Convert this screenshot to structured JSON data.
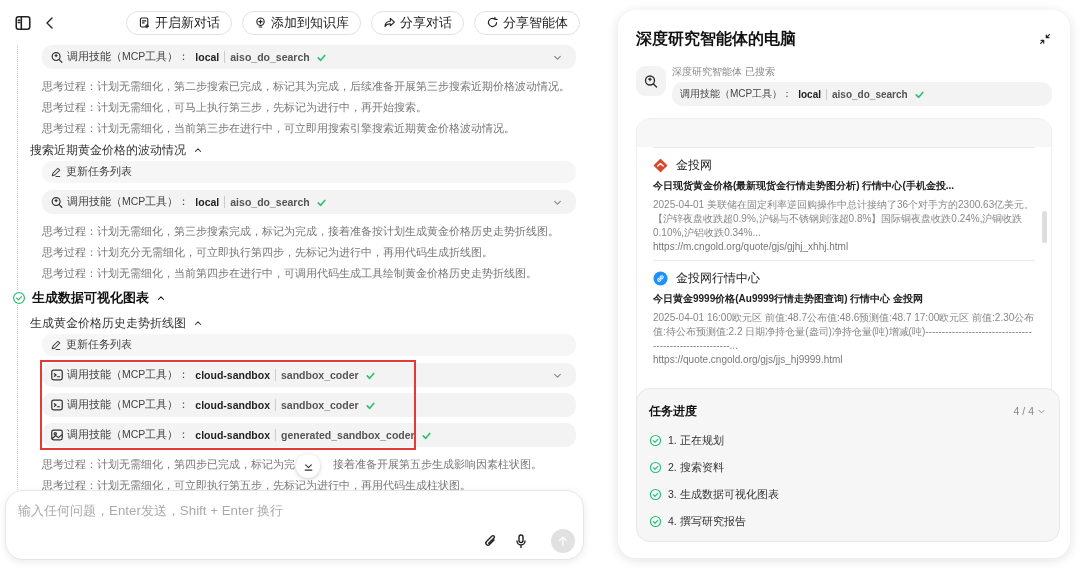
{
  "header": {
    "buttons": [
      {
        "label": "开启新对话"
      },
      {
        "label": "添加到知识库"
      },
      {
        "label": "分享对话"
      },
      {
        "label": "分享智能体"
      }
    ]
  },
  "log": [
    {
      "kind": "search-tool",
      "label": "调用技能（MCP工具）：",
      "server": "local",
      "tool": "aiso_do_search",
      "done": true,
      "expandable": true
    },
    {
      "kind": "thought",
      "text": "思考过程：计划无需细化，第二步搜索已完成，标记其为完成，后续准备开展第三步搜索近期价格波动情况。"
    },
    {
      "kind": "thought",
      "text": "思考过程：计划无需细化，可马上执行第三步，先标记为进行中，再开始搜索。"
    },
    {
      "kind": "thought",
      "text": "思考过程：计划无需细化，当前第三步在进行中，可立即用搜索引擎搜索近期黄金价格波动情况。"
    },
    {
      "kind": "section",
      "text": "搜索近期黄金价格的波动情况",
      "expanded": true
    },
    {
      "kind": "update",
      "text": "更新任务列表"
    },
    {
      "kind": "search-tool",
      "label": "调用技能（MCP工具）：",
      "server": "local",
      "tool": "aiso_do_search",
      "done": true,
      "expandable": true
    },
    {
      "kind": "thought",
      "text": "思考过程：计划无需细化，第三步搜索完成，标记为完成，接着准备按计划生成黄金价格历史走势折线图。"
    },
    {
      "kind": "thought",
      "text": "思考过程：计划充分无需细化，可立即执行第四步，先标记为进行中，再用代码生成折线图。"
    },
    {
      "kind": "thought",
      "text": "思考过程：计划无需细化，当前第四步在进行中，可调用代码生成工具绘制黄金价格历史走势折线图。"
    },
    {
      "kind": "step",
      "text": "生成数据可视化图表",
      "done": true,
      "expanded": true
    },
    {
      "kind": "section",
      "text": "生成黄金价格历史走势折线图",
      "expanded": true
    },
    {
      "kind": "update",
      "text": "更新任务列表"
    },
    {
      "kind": "group",
      "highlighted": true,
      "items": [
        {
          "kind": "code-tool",
          "label": "调用技能（MCP工具）：",
          "server": "cloud-sandbox",
          "tool": "sandbox_coder",
          "done": true,
          "expandable": true
        },
        {
          "kind": "code-tool",
          "label": "调用技能（MCP工具）：",
          "server": "cloud-sandbox",
          "tool": "sandbox_coder",
          "done": true,
          "expandable": false
        },
        {
          "kind": "image-tool",
          "label": "调用技能（MCP工具）：",
          "server": "cloud-sandbox",
          "tool": "generated_sandbox_coder",
          "done": true,
          "expandable": false
        }
      ]
    },
    {
      "kind": "thought",
      "parts": [
        "思考过程：计划无需细化，第四步已完成，标记为完",
        "接着准备开展第五步生成影响因素柱状图。"
      ]
    },
    {
      "kind": "thought",
      "text": "思考过程：计划无需细化，可立即执行第五步，先标记为进行中，再用代码生成柱状图。"
    }
  ],
  "input": {
    "placeholder": "输入任何问题，Enter发送，Shift + Enter 换行"
  },
  "panel": {
    "title": "深度研究智能体的电脑",
    "agent_status": "深度研究智能体 已搜索",
    "tool": {
      "label": "调用技能（MCP工具）：",
      "server": "local",
      "tool": "aiso_do_search",
      "done": true,
      "expandable": false
    },
    "results": [
      {
        "kind": "brand",
        "source": "金投网",
        "title": "今日现货黄金价格(最新现货金行情走势图分析) 行情中心(手机金投...",
        "snippet": "2025-04-01 美联储在固定利率逆回购操作中总计接纳了36个对手方的2300.63亿美元。【沪锌夜盘收跌超0.9%,沪锡与不锈钢则涨超0.8%】国际铜夜盘收跌0.24%,沪铜收跌0.10%,沪铝收跌0.34%...",
        "url": "https://m.cngold.org/quote/gjs/gjhj_xhhj.html"
      },
      {
        "kind": "link",
        "source": "金投网行情中心",
        "title": "今日黄金9999价格(Au9999行情走势图查询) 行情中心 金投网",
        "snippet": "2025-04-01 16:00欧元区 前值:48.7公布值:48.6预测值:48.7 17:00欧元区 前值:2.30公布值:待公布预测值:2.2 日期净持仓量(盎司)净持仓量(吨)增减(吨)-------------------------------------------------------...",
        "url": "https://quote.cngold.org/gjs/jjs_hj9999.html"
      }
    ],
    "progress": {
      "title": "任务进度",
      "count": "4 / 4",
      "tasks": [
        {
          "text": "1. 正在规划",
          "done": true
        },
        {
          "text": "2. 搜索资料",
          "done": true
        },
        {
          "text": "3. 生成数据可视化图表",
          "done": true
        },
        {
          "text": "4. 撰写研究报告",
          "done": true
        }
      ]
    }
  }
}
